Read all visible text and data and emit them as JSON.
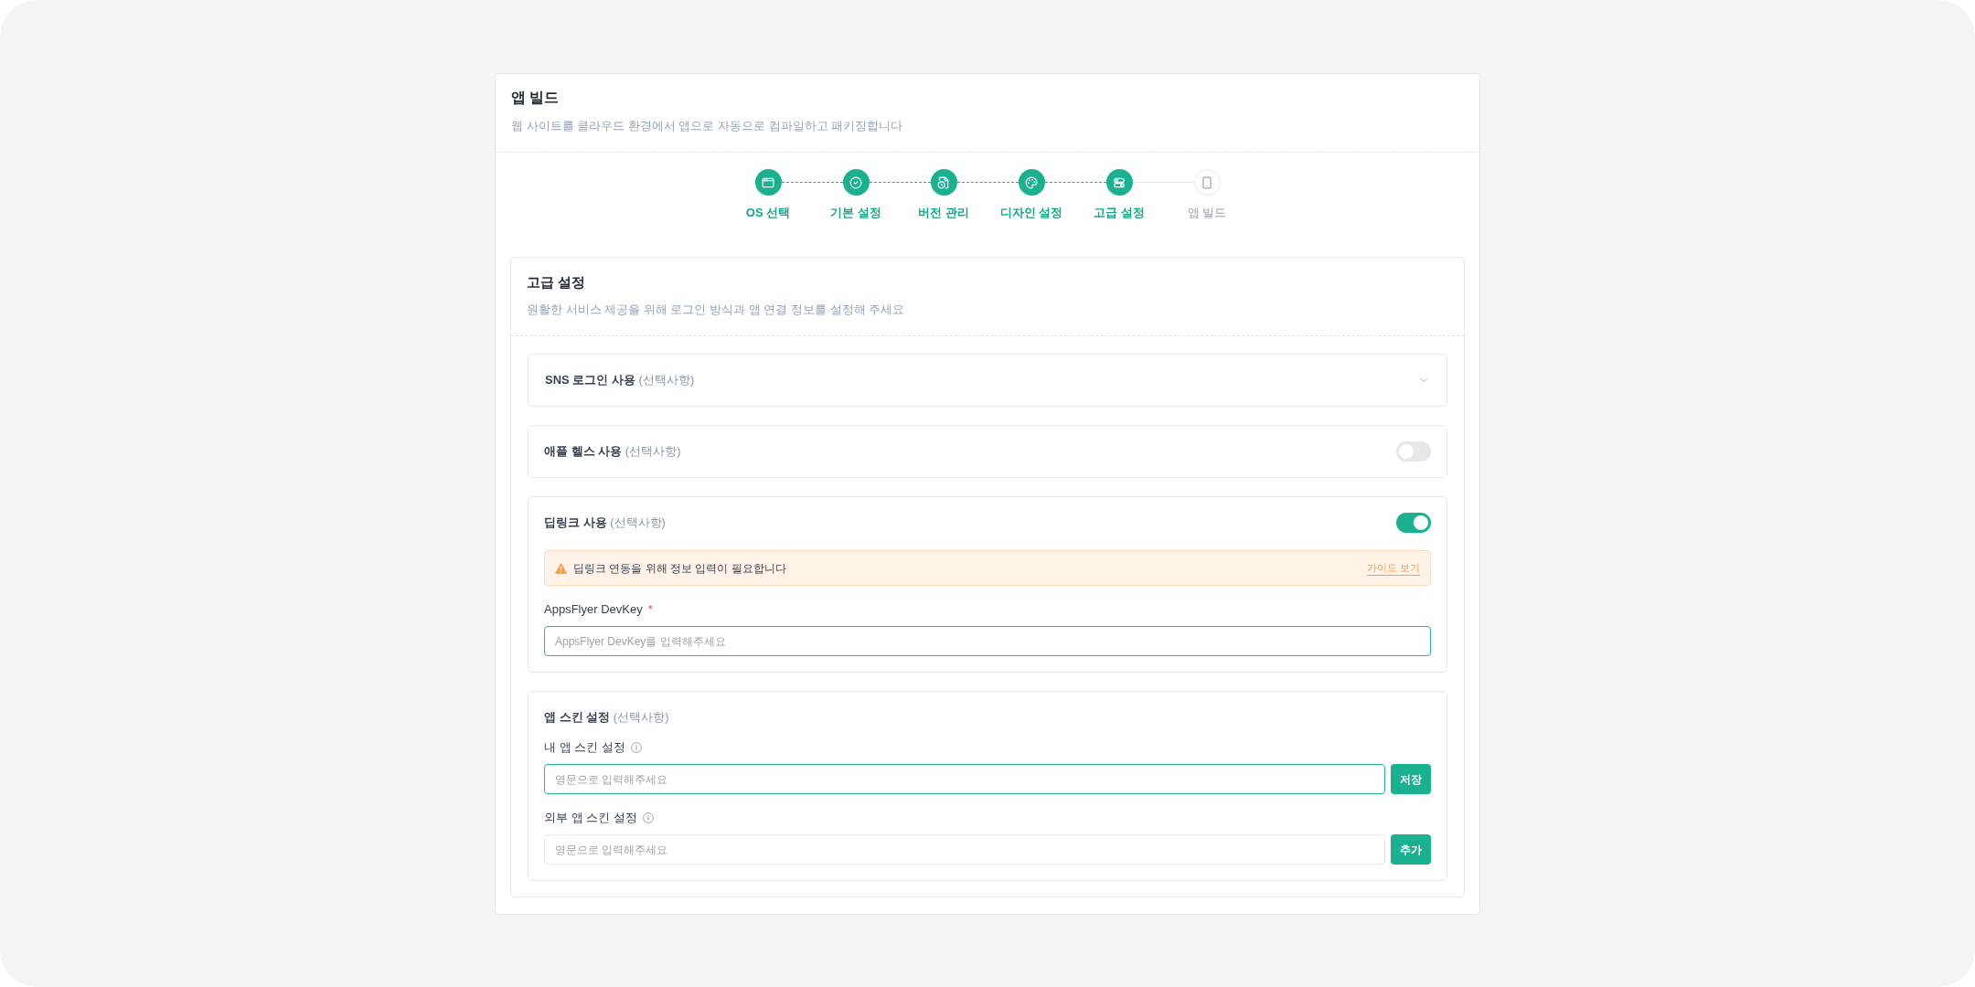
{
  "page": {
    "title": "앱 빌드",
    "subtitle": "웹 사이트를 클라우드 환경에서 앱으로 자동으로 컴파일하고 패키징합니다"
  },
  "steps": [
    {
      "label": "OS 선택",
      "done": true
    },
    {
      "label": "기본 설정",
      "done": true
    },
    {
      "label": "버전 관리",
      "done": true
    },
    {
      "label": "디자인 설정",
      "done": true
    },
    {
      "label": "고급 설정",
      "done": true
    },
    {
      "label": "앱 빌드",
      "done": false
    }
  ],
  "section": {
    "title": "고급 설정",
    "subtitle": "원활한 서비스 제공을 위해 로그인 방식과 앱 연결 정보를 설정해 주세요"
  },
  "options": [
    {
      "kind": "accordion",
      "label": "SNS 로그인 사용",
      "note": "(선택사항)",
      "expanded": false
    },
    {
      "kind": "toggle",
      "label": "애플 헬스 사용",
      "note": "(선택사항)",
      "on": false
    },
    {
      "kind": "toggle",
      "label": "딥링크 사용",
      "note": "(선택사항)",
      "on": true,
      "alert": {
        "text": "딥링크 연동을 위해 정보 입력이 필요합니다",
        "link": "가이드 보기"
      },
      "fields": [
        {
          "label": "AppsFlyer DevKey",
          "required_mark": "*",
          "placeholder": "AppsFlyer DevKey를 입력해주세요",
          "focused": true
        }
      ]
    },
    {
      "kind": "group",
      "label": "앱 스킨 설정",
      "note": "(선택사항)",
      "fields": [
        {
          "label": "내 앱 스킨 설정",
          "info": true,
          "placeholder": "영문으로 입력해주세요",
          "focused": true,
          "button": "저장"
        },
        {
          "label": "외부 앱 스킨 설정",
          "info": true,
          "placeholder": "영문으로 입력해주세요",
          "focused": false,
          "button": "추가"
        }
      ]
    }
  ]
}
